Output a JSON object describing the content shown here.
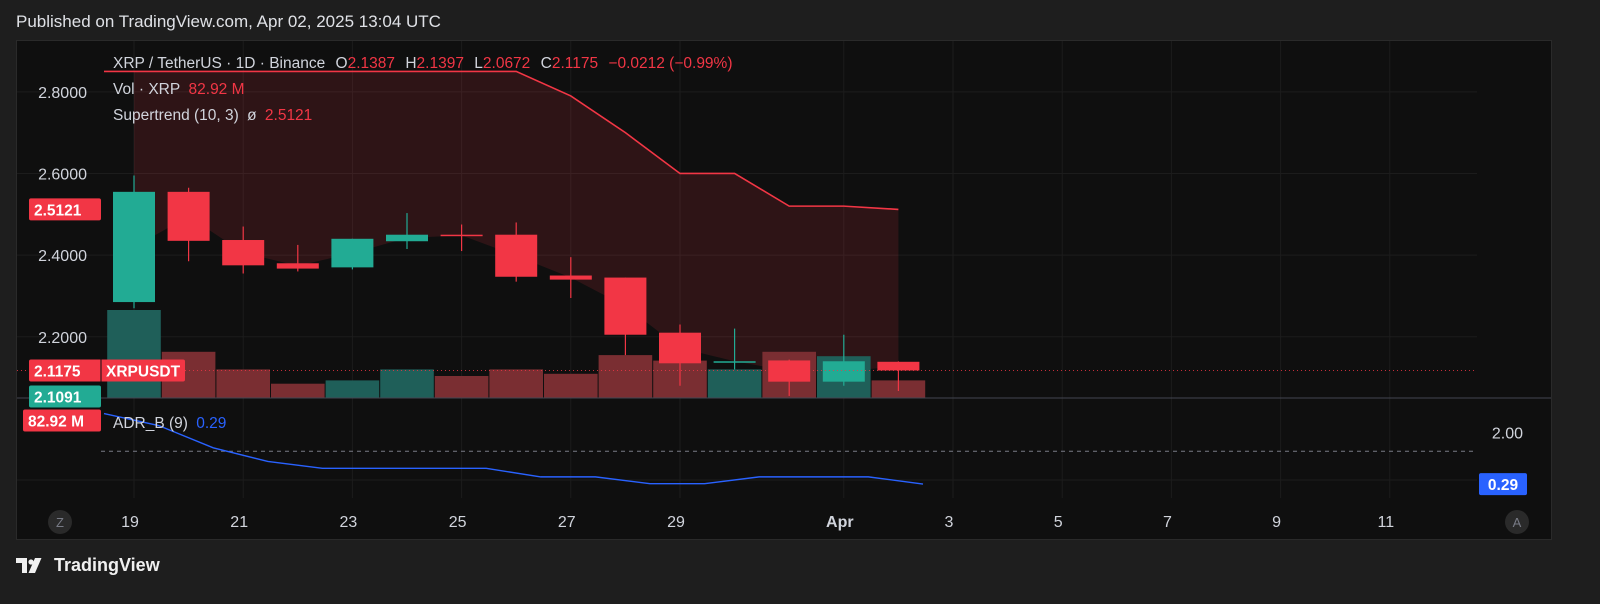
{
  "header": {
    "published": "Published on TradingView.com, Apr 02, 2025 13:04 UTC"
  },
  "footer": {
    "brand": "TradingView"
  },
  "colors": {
    "up": "#22ab94",
    "down": "#f23645",
    "volume_up": "#1f5f59",
    "volume_down": "#7a2e32",
    "supertrend": "#f23645",
    "adr": "#2962ff",
    "background": "#0f0f0f"
  },
  "legend": {
    "symbol": "XRP / TetherUS · 1D · Binance",
    "o_label": "O",
    "o_value": "2.1387",
    "h_label": "H",
    "h_value": "2.1397",
    "l_label": "L",
    "l_value": "2.0672",
    "c_label": "C",
    "c_value": "2.1175",
    "change": "−0.0212 (−0.99%)",
    "vol_label": "Vol · XRP",
    "vol_value": "82.92 M",
    "supertrend_label": "Supertrend (10, 3)",
    "supertrend_glyph": "ø",
    "supertrend_value": "2.5121",
    "adr_label": "ADR_B (9)",
    "adr_value": "0.29"
  },
  "price_tags": {
    "supertrend": "2.5121",
    "close": "2.1175",
    "close_symbol": "XRPUSDT",
    "prev": "2.1091",
    "volume": "82.92 M",
    "adr": "0.29"
  },
  "axis_buttons": {
    "left": "Z",
    "right": "A"
  },
  "chart_data": {
    "type": "candlestick",
    "symbol": "XRPUSDT",
    "interval": "1D",
    "exchange": "Binance",
    "x_axis_ticks": [
      {
        "label": "19",
        "index": 0
      },
      {
        "label": "21",
        "index": 2
      },
      {
        "label": "23",
        "index": 4
      },
      {
        "label": "25",
        "index": 6
      },
      {
        "label": "27",
        "index": 8
      },
      {
        "label": "29",
        "index": 10
      },
      {
        "label": "Apr",
        "index": 13
      },
      {
        "label": "3",
        "index": 15
      },
      {
        "label": "5",
        "index": 17
      },
      {
        "label": "7",
        "index": 19
      },
      {
        "label": "9",
        "index": 21
      },
      {
        "label": "11",
        "index": 23
      }
    ],
    "y_axis": {
      "ticks": [
        "2.8000",
        "2.6000",
        "2.4000",
        "2.2000"
      ],
      "range": [
        2.05,
        2.9
      ]
    },
    "candles": [
      {
        "date": "Mar 19",
        "o": 2.285,
        "h": 2.595,
        "l": 2.27,
        "c": 2.555
      },
      {
        "date": "Mar 20",
        "o": 2.555,
        "h": 2.565,
        "l": 2.385,
        "c": 2.435
      },
      {
        "date": "Mar 21",
        "o": 2.437,
        "h": 2.47,
        "l": 2.355,
        "c": 2.375
      },
      {
        "date": "Mar 22",
        "o": 2.38,
        "h": 2.425,
        "l": 2.36,
        "c": 2.367
      },
      {
        "date": "Mar 23",
        "o": 2.37,
        "h": 2.44,
        "l": 2.365,
        "c": 2.44
      },
      {
        "date": "Mar 24",
        "o": 2.434,
        "h": 2.503,
        "l": 2.415,
        "c": 2.45
      },
      {
        "date": "Mar 25",
        "o": 2.45,
        "h": 2.475,
        "l": 2.41,
        "c": 2.447
      },
      {
        "date": "Mar 26",
        "o": 2.45,
        "h": 2.48,
        "l": 2.335,
        "c": 2.347
      },
      {
        "date": "Mar 27",
        "o": 2.35,
        "h": 2.395,
        "l": 2.295,
        "c": 2.34
      },
      {
        "date": "Mar 28",
        "o": 2.345,
        "h": 2.345,
        "l": 2.155,
        "c": 2.205
      },
      {
        "date": "Mar 29",
        "o": 2.21,
        "h": 2.23,
        "l": 2.08,
        "c": 2.135
      },
      {
        "date": "Mar 30",
        "o": 2.14,
        "h": 2.22,
        "l": 2.12,
        "c": 2.14
      },
      {
        "date": "Mar 31",
        "o": 2.142,
        "h": 2.144,
        "l": 2.055,
        "c": 2.09
      },
      {
        "date": "Apr 01",
        "o": 2.09,
        "h": 2.205,
        "l": 2.08,
        "c": 2.14
      },
      {
        "date": "Apr 02",
        "o": 2.1387,
        "h": 2.1397,
        "l": 2.0672,
        "c": 2.1175
      }
    ],
    "volume_relative": [
      0.8,
      0.42,
      0.26,
      0.13,
      0.16,
      0.26,
      0.2,
      0.26,
      0.22,
      0.39,
      0.34,
      0.26,
      0.42,
      0.38,
      0.16
    ],
    "supertrend": [
      2.85,
      2.85,
      2.85,
      2.85,
      2.85,
      2.85,
      2.85,
      2.85,
      2.79,
      2.7,
      2.6,
      2.6,
      2.52,
      2.52,
      2.512
    ],
    "adr": {
      "label": "ADR_B (9)",
      "axis_tick": "2.00",
      "range": [
        0.0,
        2.6
      ],
      "values": [
        2.35,
        2.0,
        1.35,
        0.95,
        0.75,
        0.75,
        0.75,
        0.75,
        0.5,
        0.5,
        0.3,
        0.3,
        0.5,
        0.5,
        0.5,
        0.29
      ],
      "reference_line": 1.25
    }
  }
}
